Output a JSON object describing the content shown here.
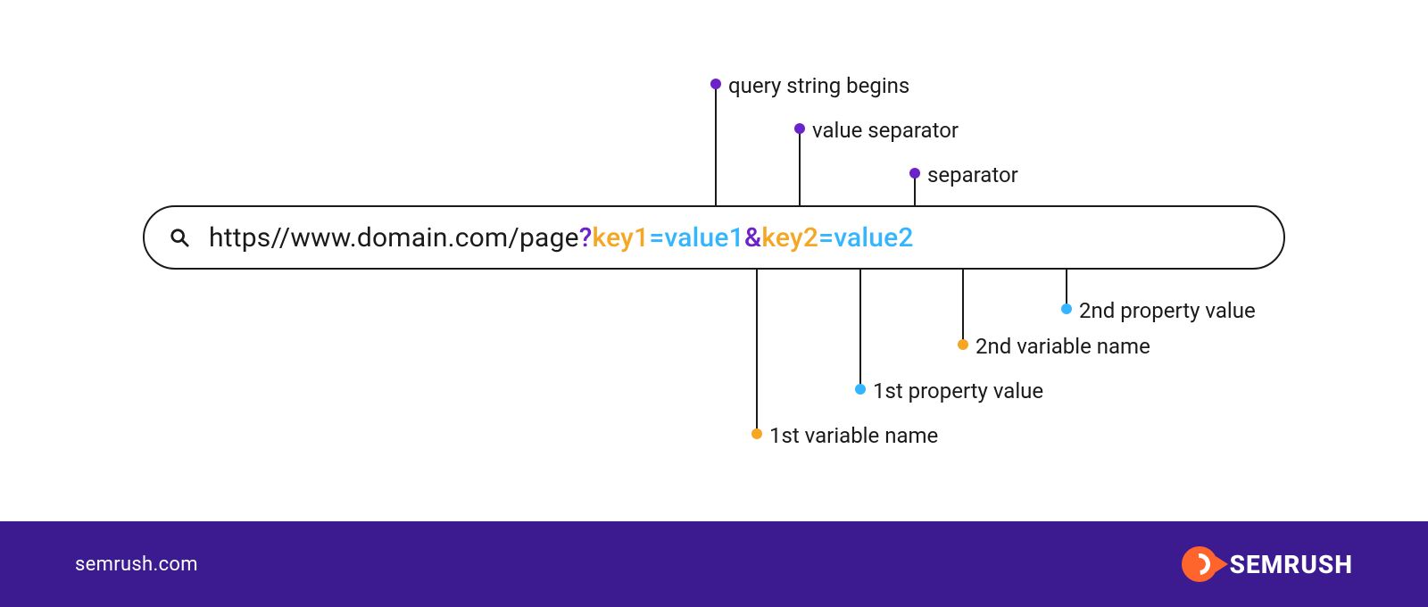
{
  "url": {
    "base": "https//www.domain.com/page",
    "qmark": "?",
    "key1": "key1",
    "eq1": "=",
    "val1": "value1",
    "amp": "&",
    "key2": "key2",
    "eq2": "=",
    "val2": "value2"
  },
  "annotations": {
    "top": {
      "qmark": "query string begins",
      "eq": "value separator",
      "amp": "separator"
    },
    "bottom": {
      "key1": "1st variable name",
      "val1": "1st property value",
      "key2": "2nd variable name",
      "val2": "2nd property value"
    }
  },
  "footer": {
    "site": "semrush.com",
    "brand": "SEMRUSH"
  },
  "colors": {
    "purple": "#6b22c9",
    "orange": "#f5a623",
    "blue": "#33b5ff",
    "footer_bg": "#3c1a8f",
    "accent_orange": "#ff642d"
  }
}
